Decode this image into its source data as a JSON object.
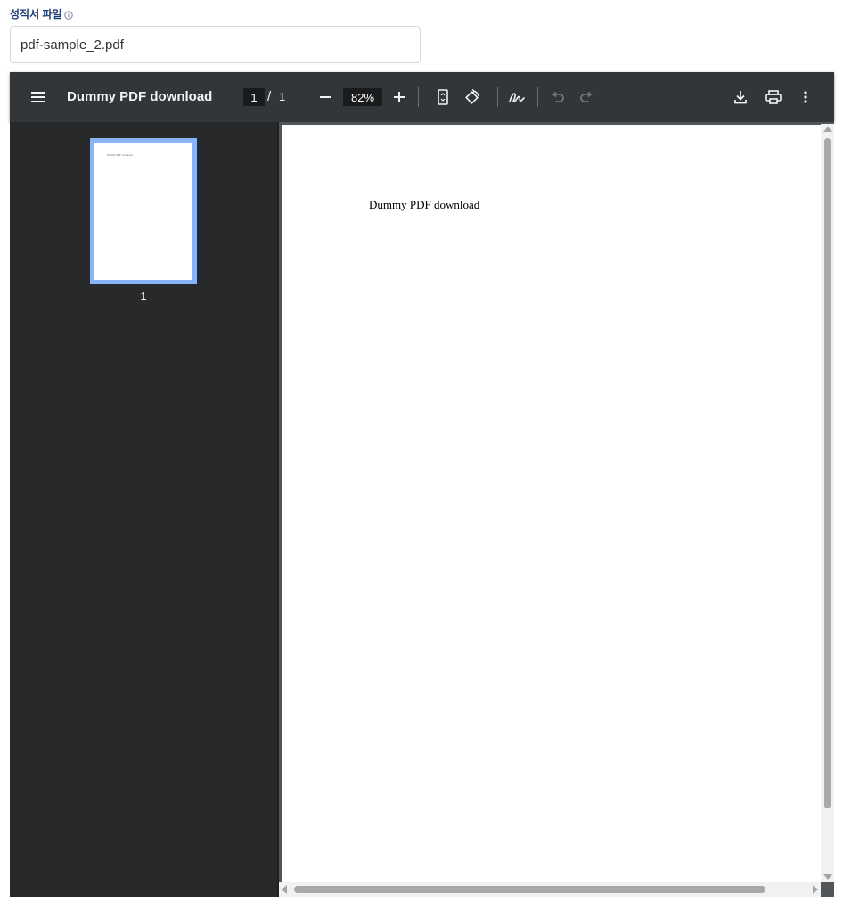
{
  "form": {
    "label": "성적서 파일",
    "info_icon": "info-circle-icon",
    "file_name": "pdf-sample_2.pdf"
  },
  "viewer": {
    "title": "Dummy PDF download",
    "current_page": "1",
    "page_separator": "/",
    "total_pages": "1",
    "zoom": "82%",
    "thumbnail_label": "1",
    "page_text": "Dummy PDF download",
    "thumbnail_text": "Dummy PDF download",
    "icons": {
      "menu": "menu-icon",
      "zoom_out": "minus-icon",
      "zoom_in": "plus-icon",
      "fit_page": "fit-page-icon",
      "rotate": "rotate-icon",
      "annotate": "draw-icon",
      "undo": "undo-icon",
      "redo": "redo-icon",
      "download": "download-icon",
      "print": "print-icon",
      "more": "more-vert-icon"
    },
    "colors": {
      "toolbar": "#323639",
      "sidebar": "#28292b",
      "thumb_highlight": "#8ab4f8"
    }
  }
}
